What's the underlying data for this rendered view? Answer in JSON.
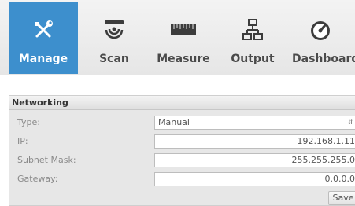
{
  "tabs": [
    {
      "id": "manage",
      "label": "Manage",
      "icon": "tools-icon",
      "active": true
    },
    {
      "id": "scan",
      "label": "Scan",
      "icon": "scanner-icon",
      "active": false
    },
    {
      "id": "measure",
      "label": "Measure",
      "icon": "ruler-icon",
      "active": false
    },
    {
      "id": "output",
      "label": "Output",
      "icon": "network-icon",
      "active": false
    },
    {
      "id": "dashboard",
      "label": "Dashboard",
      "icon": "gauge-icon",
      "active": false
    }
  ],
  "networking": {
    "title": "Networking",
    "type": {
      "label": "Type:",
      "value": "Manual"
    },
    "ip": {
      "label": "IP:",
      "value": "192.168.1.11"
    },
    "subnet_mask": {
      "label": "Subnet Mask:",
      "value": "255.255.255.0"
    },
    "gateway": {
      "label": "Gateway:",
      "value": "0.0.0.0"
    },
    "save_label": "Save"
  },
  "colors": {
    "accent": "#3d8fcd",
    "tab_text": "#4a4a4a",
    "panel_bg": "#e7e7e7"
  }
}
